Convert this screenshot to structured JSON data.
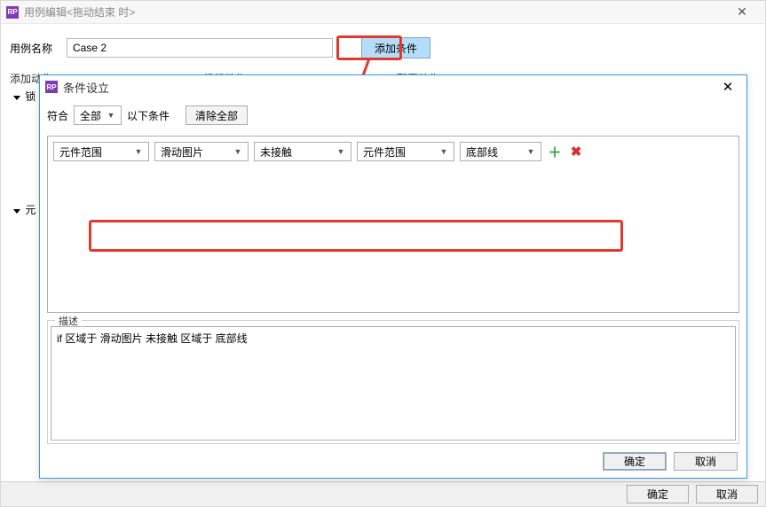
{
  "outer": {
    "title": "用例编辑<拖动结束 时>",
    "close_x": "✕",
    "name_label": "用例名称",
    "case_value": "Case 2",
    "add_cond_label": "添加条件",
    "tabs": [
      "添加动作",
      "组织动作",
      "配置动作"
    ],
    "section1": "锁",
    "section2": "元",
    "ok": "确定",
    "cancel": "取消"
  },
  "dlg": {
    "title": "条件设立",
    "close_x": "✕",
    "match_label1": "符合",
    "match_combo": "全部",
    "match_label2": "以下条件",
    "clear_label": "清除全部",
    "row": {
      "c1": "元件范围",
      "c2": "滑动图片",
      "c3": "未接触",
      "c4": "元件范围",
      "c5": "底部线"
    },
    "add_icon": "＋",
    "del_icon": "✖",
    "desc_legend": "描述",
    "desc_text": "if 区域于 滑动图片 未接触 区域于 底部线",
    "ok": "确定",
    "cancel": "取消",
    "caret": "▼"
  }
}
